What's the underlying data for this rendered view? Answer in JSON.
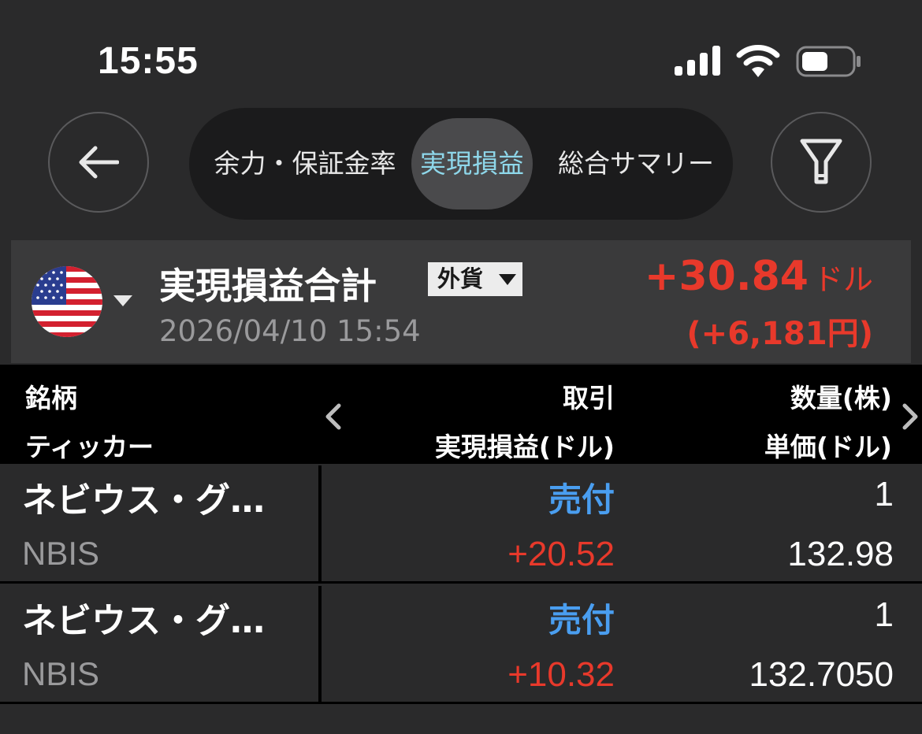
{
  "status_bar": {
    "time": "15:55",
    "icons": [
      "cellular-signal-icon",
      "wifi-icon",
      "battery-icon"
    ]
  },
  "nav": {
    "back_icon": "arrow-left-icon",
    "filter_icon": "filter-icon",
    "tabs": [
      {
        "label": "余力・保証金率",
        "selected": false
      },
      {
        "label": "実現損益",
        "selected": true
      },
      {
        "label": "総合サマリー",
        "selected": false
      }
    ]
  },
  "summary": {
    "flag_icon": "us-flag-icon",
    "title": "実現損益合計",
    "currency_badge": "外貨",
    "date": "2026/04/10 15:54",
    "amount": "+30.84",
    "amount_unit": "ドル",
    "amount_yen": "(+6,181円)"
  },
  "table": {
    "headers": {
      "name": "銘柄",
      "ticker": "ティッカー",
      "trade": "取引",
      "realized_pl": "実現損益(ドル)",
      "quantity": "数量(株)",
      "unit_price": "単価(ドル)"
    },
    "rows": [
      {
        "name": "ネビウス・グ…",
        "ticker": "NBIS",
        "trade": "売付",
        "realized_pl": "+20.52",
        "quantity": "1",
        "unit_price": "132.98"
      },
      {
        "name": "ネビウス・グ…",
        "ticker": "NBIS",
        "trade": "売付",
        "realized_pl": "+10.32",
        "quantity": "1",
        "unit_price": "132.7050"
      }
    ]
  },
  "colors": {
    "background": "#2a2a2b",
    "header_background": "#000000",
    "positive": "#e8392b",
    "trade_sell": "#4a9ef0",
    "active_tab_text": "#8ed7ea"
  }
}
